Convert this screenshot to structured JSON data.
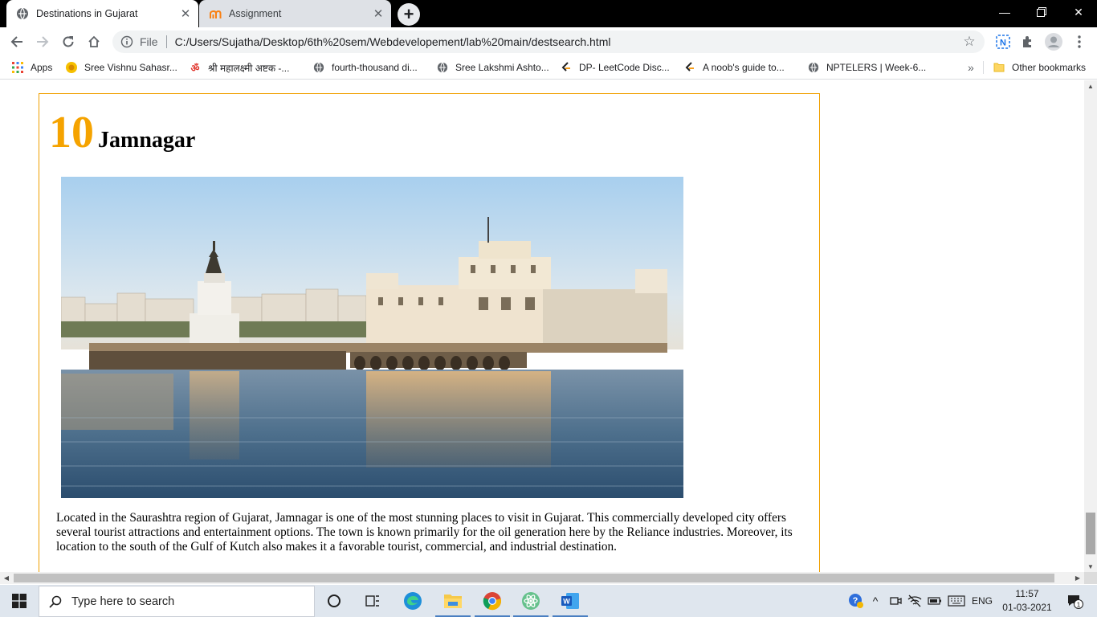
{
  "browser": {
    "tabs": [
      {
        "title": "Destinations in Gujarat",
        "active": true,
        "icon": "globe-icon"
      },
      {
        "title": "Assignment",
        "active": false,
        "icon": "moodle-icon"
      }
    ],
    "address_bar": {
      "scheme_label": "File",
      "url": "C:/Users/Sujatha/Desktop/6th%20sem/Webdevelopement/lab%20main/destsearch.html"
    },
    "bookmarks": [
      {
        "label": "Apps",
        "icon": "apps-grid-icon"
      },
      {
        "label": "Sree Vishnu Sahasr...",
        "icon": "sun-icon"
      },
      {
        "label": "श्री महालक्ष्मी अष्टक -...",
        "icon": "om-icon"
      },
      {
        "label": "fourth-thousand di...",
        "icon": "globe-icon"
      },
      {
        "label": "Sree Lakshmi Ashto...",
        "icon": "globe-icon"
      },
      {
        "label": "DP- LeetCode Disc...",
        "icon": "leetcode-icon"
      },
      {
        "label": "A noob's guide to...",
        "icon": "leetcode-icon"
      },
      {
        "label": "NPTELERS | Week-6...",
        "icon": "globe-icon"
      }
    ],
    "overflow_label": "»",
    "other_bookmarks": "Other bookmarks",
    "accent_color": "#f5a300"
  },
  "page": {
    "rank": "10",
    "name": "Jamnagar",
    "image_alt": "Lakhota Lake and Palace, Jamnagar",
    "description": "Located in the Saurashtra region of Gujarat, Jamnagar is one of the most stunning places to visit in Gujarat. This commercially developed city offers several tourist attractions and entertainment options. The town is known primarily for the oil generation here by the Reliance industries. Moreover, its location to the south of the Gulf of Kutch also makes it a favorable tourist, commercial, and industrial destination.",
    "border_color": "#f0a000"
  },
  "taskbar": {
    "search_placeholder": "Type here to search",
    "language": "ENG",
    "time": "11:57",
    "date": "01-03-2021",
    "notification_count": "1",
    "pinned": [
      "cortana-icon",
      "task-view-icon",
      "edge-icon",
      "file-explorer-icon",
      "chrome-icon",
      "atom-icon",
      "word-icon"
    ]
  }
}
